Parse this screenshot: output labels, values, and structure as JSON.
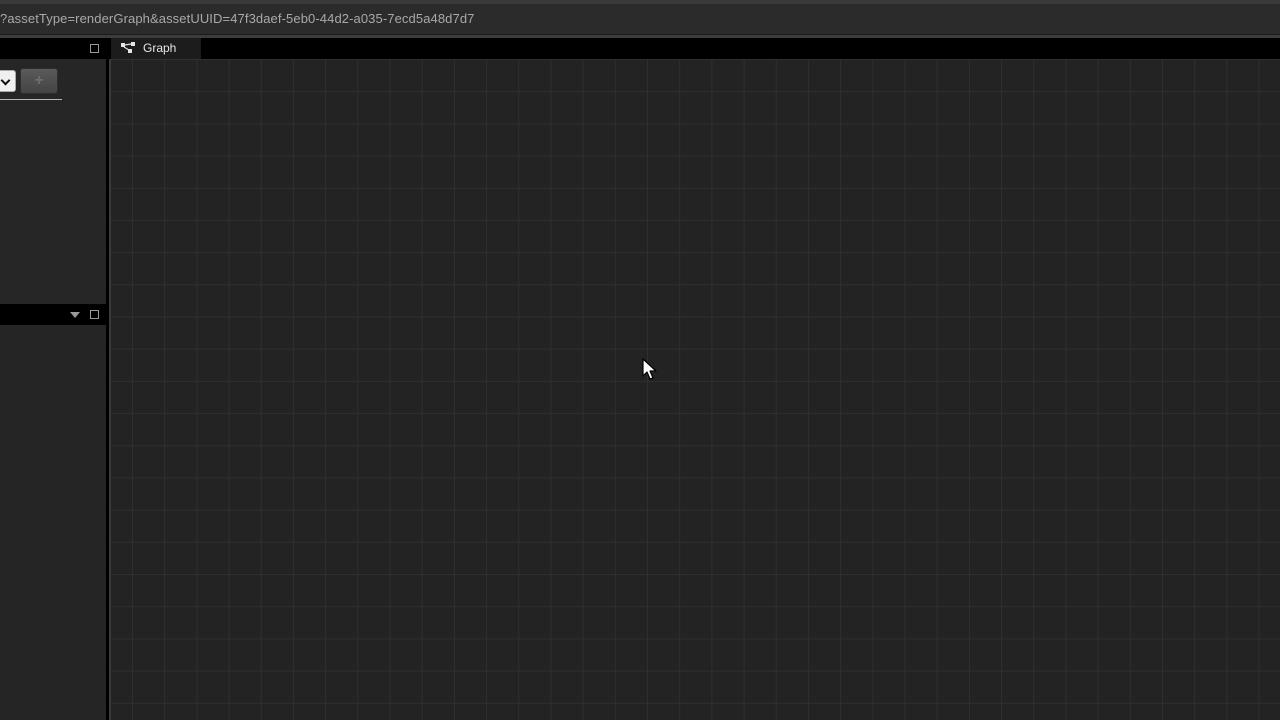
{
  "address_bar": {
    "url_text": "?assetType=renderGraph&assetUUID=47f3daef-5eb0-44d2-a035-7ecd5a48d7d7"
  },
  "tabs": [
    {
      "label": "Graph",
      "icon": "graph-node-icon",
      "active": true
    }
  ],
  "left_panel_top": {
    "add_button_label": "+",
    "icons": [
      "maximize-icon"
    ]
  },
  "left_panel_bottom": {
    "icons": [
      "chevron-down-icon",
      "maximize-icon"
    ]
  },
  "colors": {
    "background": "#232323",
    "grid_line": "#2f2f2f",
    "panel": "#252525",
    "header": "#000000",
    "text": "#a9a9a9"
  }
}
